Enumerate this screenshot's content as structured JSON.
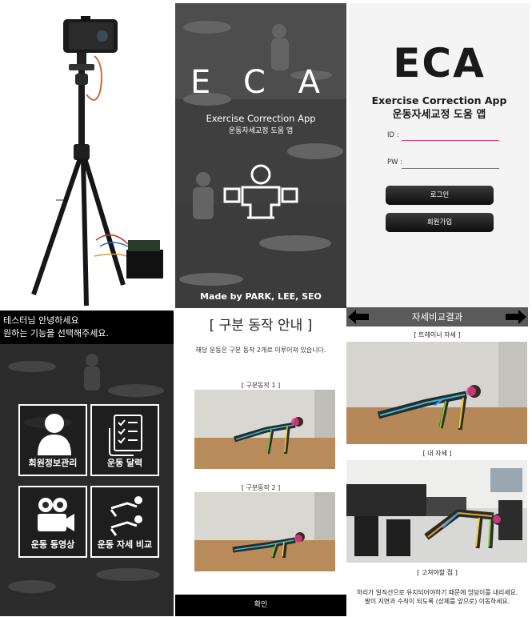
{
  "splash": {
    "title": "E C A",
    "subtitle_en": "Exercise Correction App",
    "subtitle_ko": "운동자세교정 도움 앱",
    "credit": "Made by PARK, LEE, SEO"
  },
  "login": {
    "logo": "ECA",
    "app_name_en": "Exercise Correction App",
    "app_name_ko": "운동자세교정 도움 앱",
    "id_label": "ID :",
    "pw_label": "PW :",
    "login_button": "로그인",
    "signup_button": "회원가입",
    "accent_color": "#e2377a"
  },
  "menu": {
    "greeting_line1": "테스터님 안녕하세요",
    "greeting_line2": "원하는 기능을 선택해주세요.",
    "tiles": [
      {
        "label": "회원정보관리",
        "icon": "user-icon"
      },
      {
        "label": "운동 달력",
        "icon": "checklist-icon"
      },
      {
        "label": "운동 동영상",
        "icon": "video-camera-icon"
      },
      {
        "label": "운동 자세 비교",
        "icon": "pose-compare-icon"
      }
    ]
  },
  "steps": {
    "title": "[ 구분 동작 안내 ]",
    "description": "해당 운동은 구분 동작 2개로 이루어져 있습니다.",
    "step1_caption": "[ 구분동작 1 ]",
    "step2_caption": "[ 구분동작 2 ]",
    "confirm_button": "확인"
  },
  "compare": {
    "title": "자세비교결과",
    "trainer_caption": "[ 트레이너 자세 ]",
    "mine_caption": "[ 내 자세 ]",
    "fix_caption": "[ 고쳐야할 점 ]",
    "fix_line1": "허리가 일직선으로 유지되어야하기 때문에 엉덩이를 내리세요.",
    "fix_line2": "팔이 지면과 수직이 되도록 (상체를 앞으로) 이동하세요."
  }
}
